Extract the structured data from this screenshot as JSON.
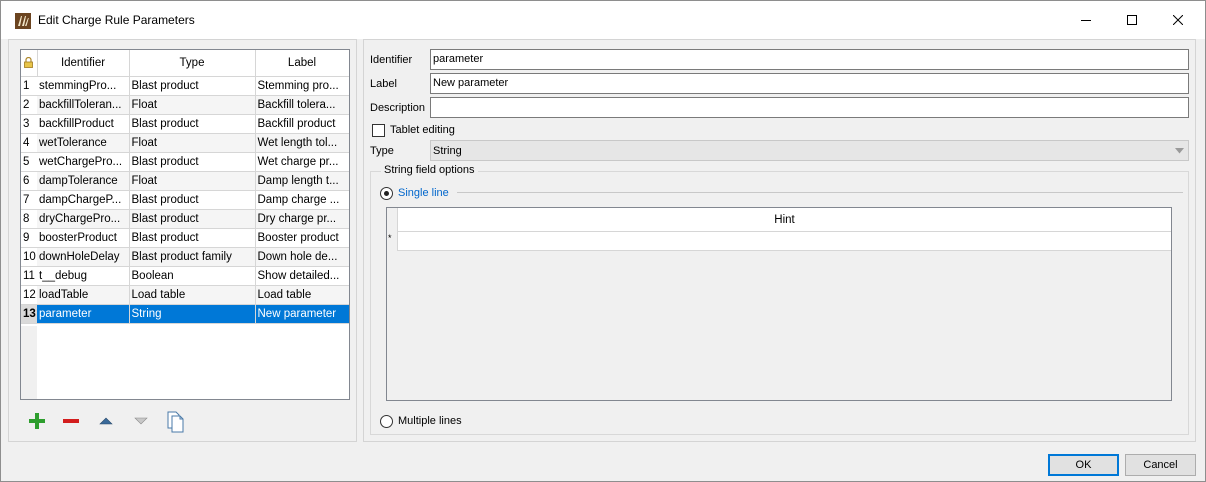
{
  "window": {
    "title": "Edit Charge Rule Parameters",
    "controls": [
      "minimize",
      "maximize",
      "close"
    ]
  },
  "params_table": {
    "headers": {
      "identifier": "Identifier",
      "type": "Type",
      "label": "Label"
    },
    "rows": [
      {
        "num": "1",
        "identifier": "stemmingPro...",
        "type": "Blast product",
        "label": "Stemming pro..."
      },
      {
        "num": "2",
        "identifier": "backfillToleran...",
        "type": "Float",
        "label": "Backfill tolera..."
      },
      {
        "num": "3",
        "identifier": "backfillProduct",
        "type": "Blast product",
        "label": "Backfill product"
      },
      {
        "num": "4",
        "identifier": "wetTolerance",
        "type": "Float",
        "label": "Wet length tol..."
      },
      {
        "num": "5",
        "identifier": "wetChargePro...",
        "type": "Blast product",
        "label": "Wet charge pr..."
      },
      {
        "num": "6",
        "identifier": "dampTolerance",
        "type": "Float",
        "label": "Damp length t..."
      },
      {
        "num": "7",
        "identifier": "dampChargeP...",
        "type": "Blast product",
        "label": "Damp charge ..."
      },
      {
        "num": "8",
        "identifier": "dryChargePro...",
        "type": "Blast product",
        "label": "Dry charge pr..."
      },
      {
        "num": "9",
        "identifier": "boosterProduct",
        "type": "Blast product",
        "label": "Booster product"
      },
      {
        "num": "10",
        "identifier": "downHoleDelay",
        "type": "Blast product family",
        "label": "Down hole de..."
      },
      {
        "num": "11",
        "identifier": "t__debug",
        "type": "Boolean",
        "label": "Show detailed..."
      },
      {
        "num": "12",
        "identifier": "loadTable",
        "type": "Load table",
        "label": "Load table"
      },
      {
        "num": "13",
        "identifier": "parameter",
        "type": "String",
        "label": "New parameter"
      }
    ],
    "selected_row": 13
  },
  "toolbar": {
    "add": "add-icon",
    "remove": "remove-icon",
    "move_up": "arrow-up-icon",
    "move_down": "arrow-down-icon",
    "copy": "copy-icon"
  },
  "form": {
    "identifier_label": "Identifier",
    "identifier_value": "parameter",
    "label_label": "Label",
    "label_value": "New parameter",
    "description_label": "Description",
    "description_value": "",
    "tablet_editing_label": "Tablet editing",
    "tablet_editing_checked": false,
    "type_label": "Type",
    "type_value": "String"
  },
  "string_options": {
    "group_title": "String field options",
    "single_line_label": "Single line",
    "single_line_selected": true,
    "multiple_lines_label": "Multiple lines",
    "hint_header": "Hint",
    "new_row_marker": "*"
  },
  "buttons": {
    "ok": "OK",
    "cancel": "Cancel"
  },
  "colors": {
    "selection": "#0078d7",
    "link_blue": "#0066cc",
    "add_green": "#2e9e2e",
    "remove_red": "#d31d1d"
  }
}
